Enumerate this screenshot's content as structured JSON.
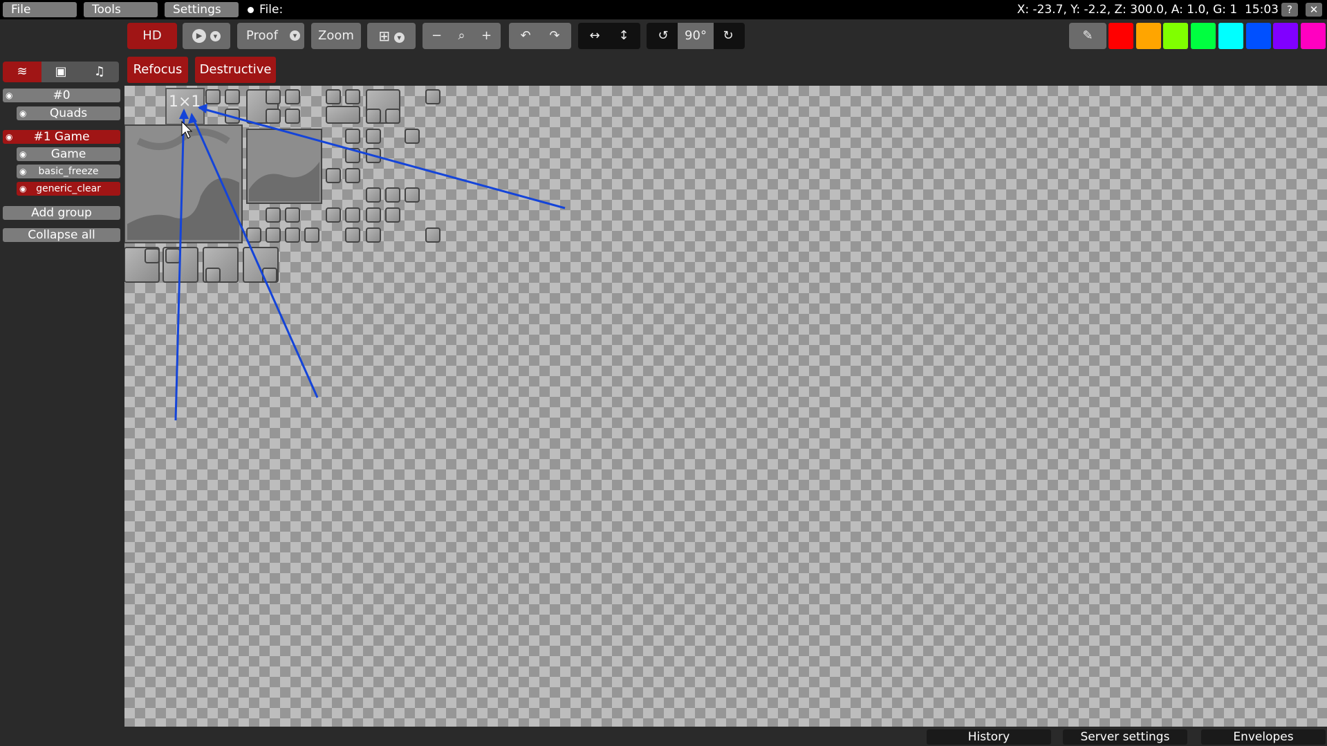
{
  "menu": {
    "file": "File",
    "tools": "Tools",
    "settings": "Settings",
    "file_label": "File:"
  },
  "status": {
    "coords": "X: -23.7, Y: -2.2, Z: 300.0, A: 1.0, G: 1",
    "time": "15:03",
    "help": "?",
    "close": "✕"
  },
  "toolbar": {
    "hd": "HD",
    "proof": "Proof",
    "zoom": "Zoom",
    "rotate_value": "90°"
  },
  "colors": [
    "#ff0000",
    "#ffa500",
    "#80ff00",
    "#00ff40",
    "#00ffff",
    "#0050ff",
    "#8000ff",
    "#ff00c0"
  ],
  "sidebar": {
    "groups": [
      {
        "name": "#0",
        "layers": [
          "Quads"
        ]
      },
      {
        "name": "#1 Game",
        "layers": [
          "Game",
          "basic_freeze",
          "generic_clear"
        ]
      }
    ],
    "add_group": "Add group",
    "collapse_all": "Collapse all"
  },
  "modes": {
    "refocus": "Refocus",
    "destructive": "Destructive"
  },
  "canvas": {
    "tile_label": "1×1"
  },
  "bottom": {
    "history": "History",
    "server_settings": "Server settings",
    "envelopes": "Envelopes"
  }
}
